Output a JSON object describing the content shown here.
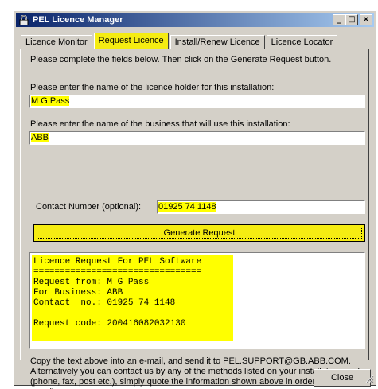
{
  "window": {
    "title": "PEL Licence Manager"
  },
  "title_buttons": {
    "minimize": "_",
    "maximize": "□",
    "close": "×"
  },
  "tabs": [
    {
      "label": "Licence Monitor",
      "active": false
    },
    {
      "label": "Request Licence",
      "active": true
    },
    {
      "label": "Install/Renew Licence",
      "active": false
    },
    {
      "label": "Licence Locator",
      "active": false
    }
  ],
  "panel": {
    "intro": "Please complete the fields below. Then click on the Generate Request button.",
    "holder_label": "Please enter the name of the licence holder for this installation:",
    "holder_value": "M G Pass",
    "business_label": "Please enter the name of the business that will use this installation:",
    "business_value": "ABB",
    "contact_label": "Contact Number (optional):",
    "contact_value": "01925 74 1148",
    "generate_label": "Generate Request",
    "output_lines": [
      "Licence Request For PEL Software",
      "================================",
      "Request from: M G Pass",
      "For Business: ABB",
      "Contact  no.: 01925 74 1148",
      "",
      "Request code: 200416082032130"
    ],
    "description": "Copy the text above into an e-mail, and send it to PEL.SUPPORT@GB.ABB.COM. Alternatively you can contact us by any of the methods listed on your installation media (phone, fax, post etc.), simply quote the information shown above in order to receive your licence."
  },
  "close_label": "Close",
  "colors": {
    "highlight": "#ffff00",
    "tab_active": "#f5ec12",
    "titlebar": "#0a246a"
  }
}
